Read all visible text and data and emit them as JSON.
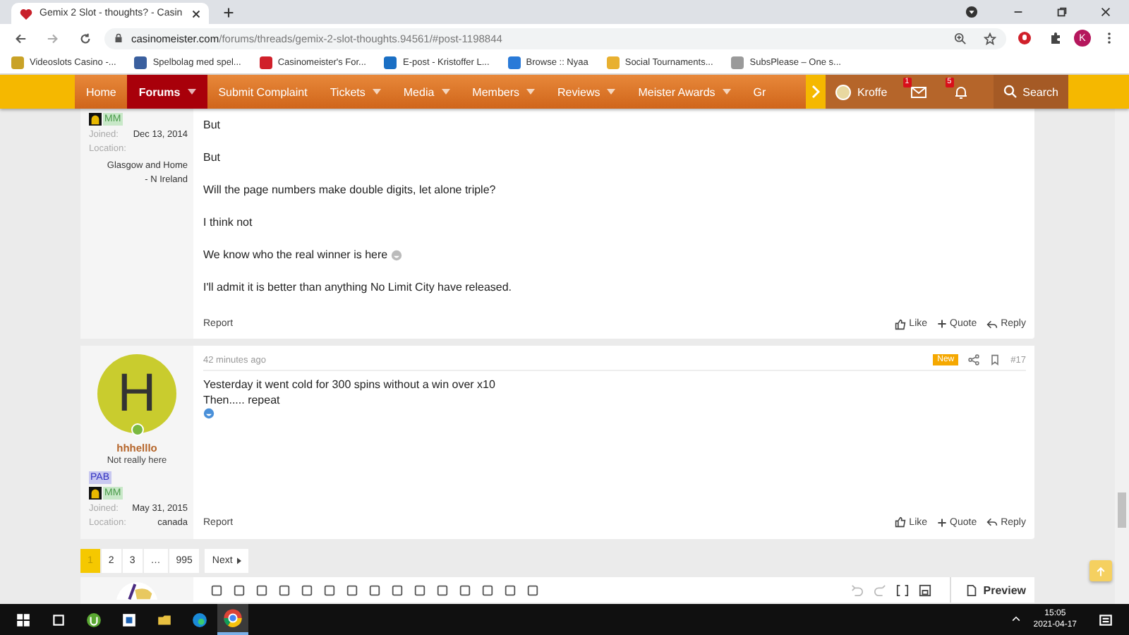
{
  "browser": {
    "tab_title": "Gemix 2 Slot - thoughts? - Casin",
    "url_host": "casinomeister.com",
    "url_path": "/forums/threads/gemix-2-slot-thoughts.94561/#post-1198844",
    "profile_initial": "K",
    "bookmarks": [
      {
        "label": "Videoslots Casino -...",
        "color": "#c9a227"
      },
      {
        "label": "Spelbolag med spel...",
        "color": "#3a5f9e"
      },
      {
        "label": "Casinomeister's For...",
        "color": "#d0202a"
      },
      {
        "label": "E-post - Kristoffer L...",
        "color": "#1a6fc4"
      },
      {
        "label": "Browse :: Nyaa",
        "color": "#2a7ad8"
      },
      {
        "label": "Social Tournaments...",
        "color": "#e8b030"
      },
      {
        "label": "SubsPlease – One s...",
        "color": "#9a9a9a"
      }
    ]
  },
  "nav": {
    "items": [
      {
        "label": "Home",
        "selected": false,
        "dropdown": false
      },
      {
        "label": "Forums",
        "selected": true,
        "dropdown": true
      },
      {
        "label": "Submit Complaint",
        "selected": false,
        "dropdown": false
      },
      {
        "label": "Tickets",
        "selected": false,
        "dropdown": true
      },
      {
        "label": "Media",
        "selected": false,
        "dropdown": true
      },
      {
        "label": "Members",
        "selected": false,
        "dropdown": true
      },
      {
        "label": "Reviews",
        "selected": false,
        "dropdown": true
      },
      {
        "label": "Meister Awards",
        "selected": false,
        "dropdown": true
      },
      {
        "label": "Gr",
        "selected": false,
        "dropdown": false
      }
    ],
    "user": "Kroffe",
    "inbox_count": "1",
    "alerts_count": "5",
    "search": "Search"
  },
  "posts": [
    {
      "badges": [
        {
          "label": "MM",
          "kind": "mm"
        }
      ],
      "joined_label": "Joined:",
      "joined": "Dec 13, 2014",
      "location_label": "Location:",
      "location": "Glasgow and Home - N Ireland",
      "spaced": true,
      "body": [
        {
          "kind": "text",
          "text": "But",
          "emoji": false
        },
        {
          "kind": "text",
          "text": "But",
          "emoji": false
        },
        {
          "kind": "text",
          "text": "Will the page numbers make double digits, let alone triple?",
          "emoji": false
        },
        {
          "kind": "text",
          "text": "I think not",
          "emoji": false
        },
        {
          "kind": "text",
          "text": "We know who the real winner is here",
          "emoji": true
        },
        {
          "kind": "text",
          "text": "I'll admit it is better than anything No Limit City have released.",
          "emoji": false
        }
      ],
      "report": "Report",
      "actions": [
        "Like",
        "Quote",
        "Reply"
      ]
    },
    {
      "avatar_letter": "H",
      "username": "hhhelllo",
      "user_title": "Not really here",
      "badges": [
        {
          "label": "PAB",
          "kind": "pab"
        },
        {
          "label": "MM",
          "kind": "mm"
        }
      ],
      "joined_label": "Joined:",
      "joined": "May 31, 2015",
      "location_label": "Location:",
      "location": "canada",
      "time": "42 minutes ago",
      "new_label": "New",
      "number": "#17",
      "spaced": false,
      "body": [
        {
          "kind": "text",
          "text": "Yesterday it went cold for 300 spins without a win over x10",
          "emoji": false
        },
        {
          "kind": "text",
          "text": "Then..... repeat",
          "emoji": false
        },
        {
          "kind": "emoji"
        }
      ],
      "report": "Report",
      "actions": [
        "Like",
        "Quote",
        "Reply"
      ]
    }
  ],
  "pagination": [
    {
      "label": "1",
      "selected": true
    },
    {
      "label": "2",
      "selected": false
    },
    {
      "label": "3",
      "selected": false
    },
    {
      "label": "…",
      "selected": false
    },
    {
      "label": "995",
      "selected": false
    }
  ],
  "next": "Next",
  "preview": "Preview",
  "taskbar": {
    "time": "15:05",
    "date": "2021-04-17"
  }
}
